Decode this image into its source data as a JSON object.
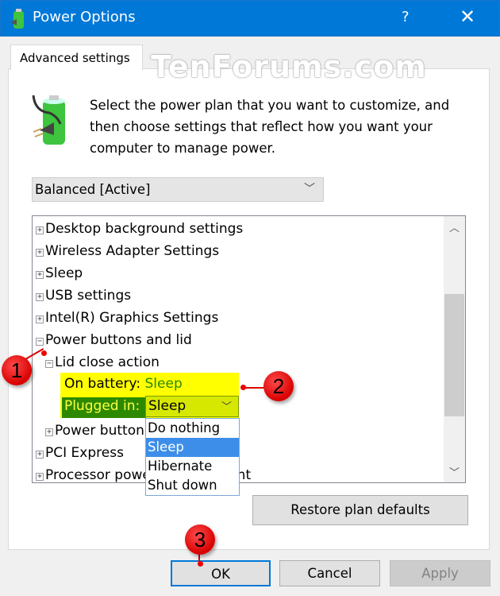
{
  "window": {
    "title": "Power Options",
    "help_label": "?",
    "close_label": "✕",
    "icon": "power-options-battery-icon"
  },
  "tab": {
    "label": "Advanced settings"
  },
  "watermark": "TenForums.com",
  "description": "Select the power plan that you want to customize, and then choose settings that reflect how you want your computer to manage power.",
  "plan_select": {
    "value": "Balanced [Active]"
  },
  "tree": {
    "items": [
      {
        "label": "Desktop background settings",
        "expander": "+"
      },
      {
        "label": "Wireless Adapter Settings",
        "expander": "+"
      },
      {
        "label": "Sleep",
        "expander": "+"
      },
      {
        "label": "USB settings",
        "expander": "+"
      },
      {
        "label": "Intel(R) Graphics Settings",
        "expander": "+"
      },
      {
        "label": "Power buttons and lid",
        "expander": "−"
      },
      {
        "label": "Lid close action",
        "expander": "−"
      },
      {
        "label": "Power button action",
        "expander": "+"
      },
      {
        "label": "PCI Express",
        "expander": "+"
      },
      {
        "label": "Processor power management",
        "expander": "+"
      }
    ],
    "on_battery": {
      "label": "On battery:",
      "value": "Sleep"
    },
    "plugged_in": {
      "label": "Plugged in:",
      "value": "Sleep",
      "options": [
        "Do nothing",
        "Sleep",
        "Hibernate",
        "Shut down"
      ],
      "selected": "Sleep"
    }
  },
  "buttons": {
    "restore": "Restore plan defaults",
    "ok": "OK",
    "cancel": "Cancel",
    "apply": "Apply"
  },
  "callouts": [
    "1",
    "2",
    "3"
  ],
  "colors": {
    "titlebar": "#0078d7",
    "highlight": "#ffff00",
    "plugged_bg": "#2d8a00",
    "selected_option": "#3c8ee8",
    "callout": "#e00000"
  }
}
